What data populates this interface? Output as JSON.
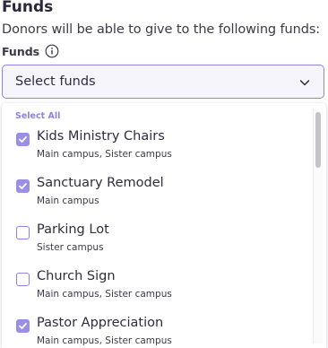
{
  "section": {
    "title": "Funds",
    "description": "Donors will be able to give to the following funds:"
  },
  "field": {
    "label": "Funds",
    "info_icon": "info-icon"
  },
  "select": {
    "placeholder": "Select funds",
    "chevron_icon": "chevron-down-icon"
  },
  "dropdown": {
    "select_all_label": "Select All",
    "options": [
      {
        "name": "Kids Ministry Chairs",
        "campuses": "Main campus, Sister campus",
        "checked": true
      },
      {
        "name": "Sanctuary Remodel",
        "campuses": "Main campus",
        "checked": true
      },
      {
        "name": "Parking Lot",
        "campuses": "Sister campus",
        "checked": false
      },
      {
        "name": "Church Sign",
        "campuses": "Main campus, Sister campus",
        "checked": false
      },
      {
        "name": "Pastor Appreciation",
        "campuses": "Main campus, Sister campus",
        "checked": true
      }
    ]
  },
  "colors": {
    "accent": "#8f82e6",
    "checkbox_fill": "#9a8fe6",
    "select_background": "#f6f5fc",
    "text": "#2f2c3f"
  }
}
